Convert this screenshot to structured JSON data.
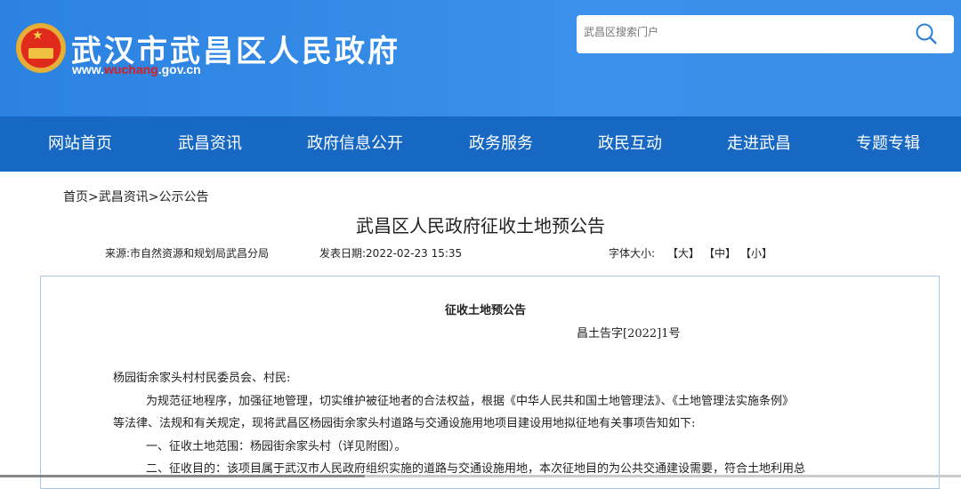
{
  "header": {
    "site_title": "武汉市武昌区人民政府",
    "url_prefix": "www.",
    "url_domain": "wuchang",
    "url_suffix": ".gov.cn",
    "search_placeholder": "武昌区搜索门户"
  },
  "nav": [
    "网站首页",
    "武昌资讯",
    "政府信息公开",
    "政务服务",
    "政民互动",
    "走进武昌",
    "专题专辑"
  ],
  "breadcrumb": "首页>武昌资讯>公示公告",
  "article": {
    "title": "武昌区人民政府征收土地预公告",
    "source": "来源:市自然资源和规划局武昌分局",
    "date": "发表日期:2022-02-23 15:35",
    "font_size_label": "字体大小:",
    "font_large": "【大】",
    "font_medium": "【中】",
    "font_small": "【小】"
  },
  "body": {
    "heading": "征收土地预公告",
    "doc_number": "昌土告字[2022]1号",
    "salutation": "杨园街余家头村村民委员会、村民:",
    "para1_line1": "为规范征地程序，加强征地管理，切实维护被征地者的合法权益，根据《中华人民共和国土地管理法》、《土地管理法实施条例》",
    "para1_line2": "等法律、法规和有关规定，现将武昌区杨园街余家头村道路与交通设施用地项目建设用地拟征地有关事项告知如下:",
    "item1": "一、征收土地范围：杨园街余家头村（详见附图）。",
    "item2": "二、征收目的：该项目属于武汉市人民政府组织实施的道路与交通设施用地，本次征地目的为公共交通建设需要，符合土地利用总"
  }
}
